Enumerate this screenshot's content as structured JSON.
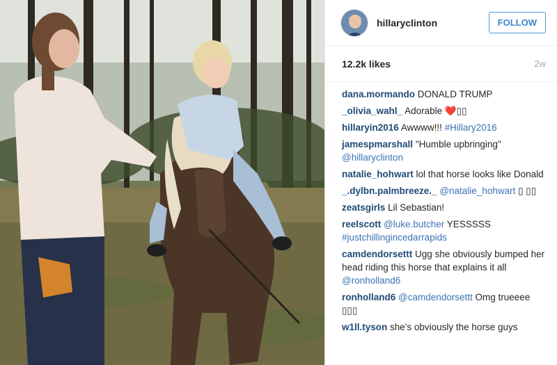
{
  "post": {
    "username": "hillaryclinton",
    "follow_label": "FOLLOW",
    "likes": "12.2k likes",
    "time_ago": "2w"
  },
  "comments": [
    {
      "user": "dana.mormando",
      "parts": [
        {
          "t": "text",
          "v": "DONALD TRUMP"
        }
      ]
    },
    {
      "user": "_olivia_wahl_",
      "parts": [
        {
          "t": "text",
          "v": "Adorable ❤️▯▯"
        }
      ]
    },
    {
      "user": "hillaryin2016",
      "parts": [
        {
          "t": "text",
          "v": "Awwww!!! "
        },
        {
          "t": "tag",
          "v": "#Hillary2016"
        }
      ]
    },
    {
      "user": "jamespmarshall",
      "parts": [
        {
          "t": "text",
          "v": "\"Humble upbringing\" "
        },
        {
          "t": "mention",
          "v": "@hillaryclinton"
        }
      ]
    },
    {
      "user": "natalie_hohwart",
      "parts": [
        {
          "t": "text",
          "v": "lol that horse looks like Donald"
        }
      ]
    },
    {
      "user": "_.dylbn.palmbreeze._",
      "parts": [
        {
          "t": "mention",
          "v": "@natalie_hohwart"
        },
        {
          "t": "text",
          "v": " ▯ ▯▯"
        }
      ]
    },
    {
      "user": "zeatsgirls",
      "parts": [
        {
          "t": "text",
          "v": "Lil Sebastian!"
        }
      ]
    },
    {
      "user": "reelscott",
      "parts": [
        {
          "t": "mention",
          "v": "@luke.butcher"
        },
        {
          "t": "text",
          "v": " YESSSSS "
        },
        {
          "t": "tag",
          "v": "#justchillingincedarrapids"
        }
      ]
    },
    {
      "user": "camdendorsettt",
      "parts": [
        {
          "t": "text",
          "v": "Ugg she obviously bumped her head riding this horse that explains it all "
        },
        {
          "t": "mention",
          "v": "@ronholland6"
        }
      ]
    },
    {
      "user": "ronholland6",
      "parts": [
        {
          "t": "mention",
          "v": "@camdendorsettt"
        },
        {
          "t": "text",
          "v": " Omg trueeee ▯▯▯"
        }
      ]
    },
    {
      "user": "w1ll.tyson",
      "parts": [
        {
          "t": "text",
          "v": "she's obviously the horse guys"
        }
      ]
    }
  ]
}
